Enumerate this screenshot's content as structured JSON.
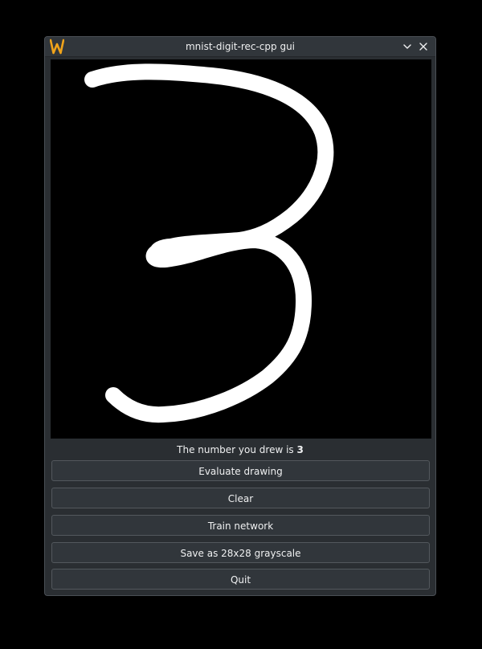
{
  "window": {
    "title": "mnist-digit-rec-cpp gui"
  },
  "result": {
    "prefix": "The number you drew is ",
    "digit": "3"
  },
  "buttons": {
    "evaluate": "Evaluate drawing",
    "clear": "Clear",
    "train": "Train network",
    "save": "Save as 28x28 grayscale",
    "quit": "Quit"
  },
  "icons": {
    "app": "w-logo-icon",
    "minimize": "chevron-down-icon",
    "close": "close-icon"
  },
  "colors": {
    "window_bg": "#2a2e32",
    "titlebar_bg": "#31363b",
    "button_bg": "#31363b",
    "button_border": "#53585d",
    "text": "#eff0f1",
    "canvas_bg": "#000000",
    "stroke": "#ffffff",
    "app_icon": "#f0a31a"
  }
}
